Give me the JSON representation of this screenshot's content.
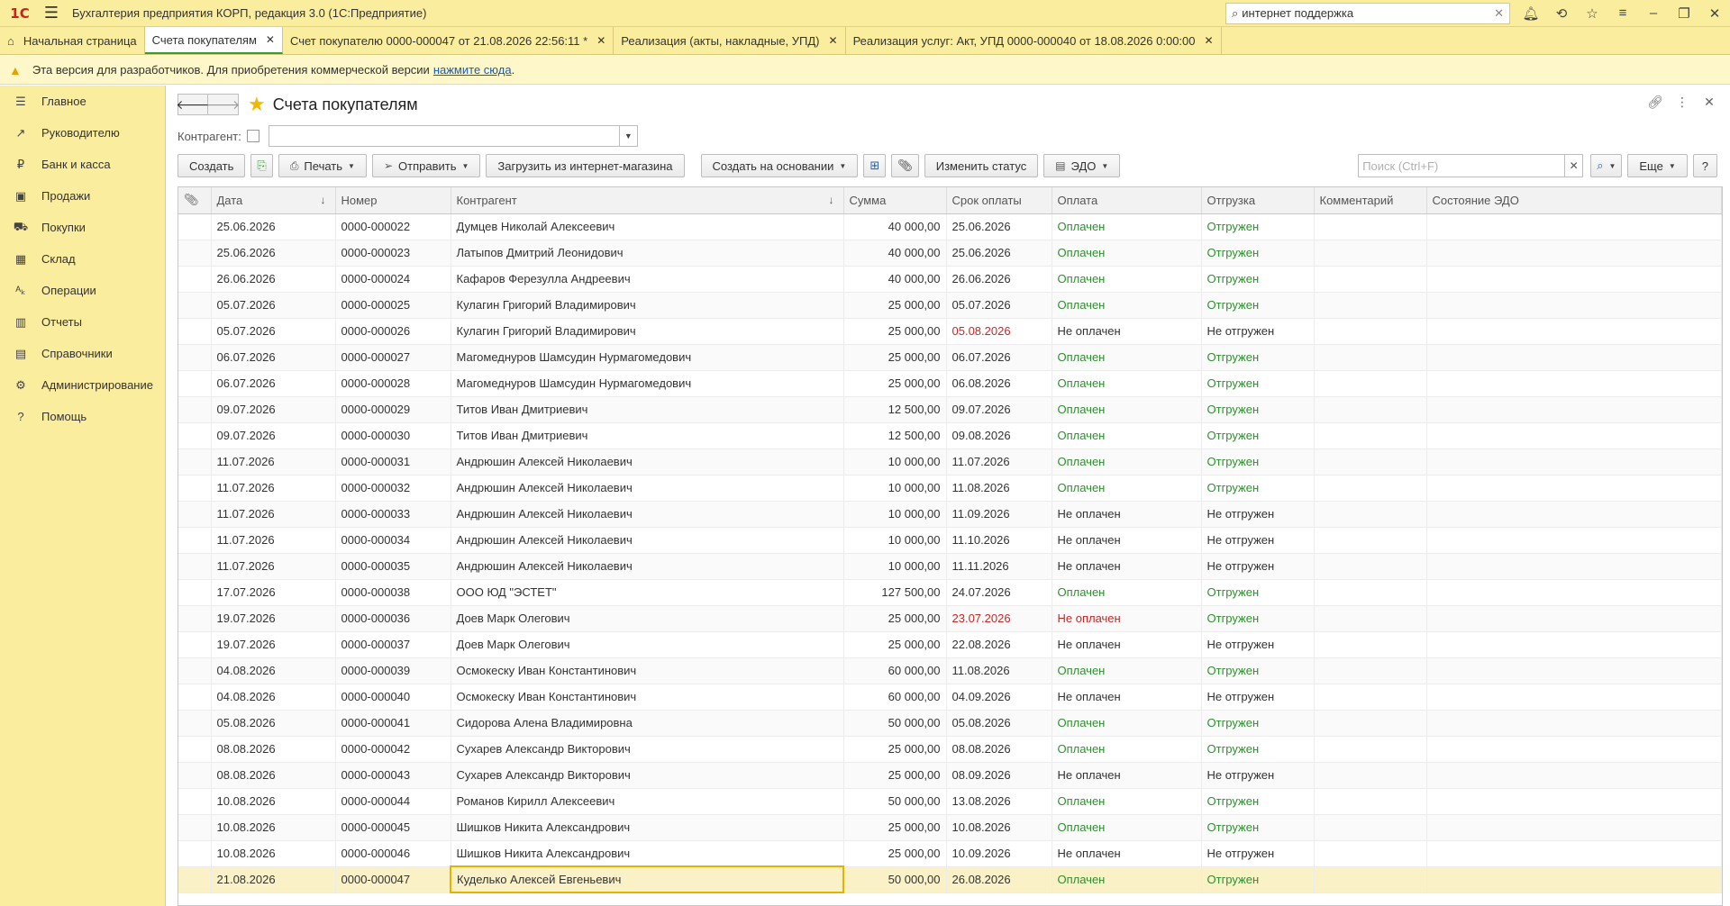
{
  "titlebar": {
    "logo": "1С",
    "app_title": "Бухгалтерия предприятия КОРП, редакция 3.0  (1С:Предприятие)",
    "search_value": "интернет поддержка",
    "icons": [
      "bell-icon",
      "history-icon",
      "star-icon",
      "settings-icon",
      "minimize-icon",
      "restore-icon",
      "close-icon"
    ]
  },
  "tabs": [
    {
      "label": "Начальная страница",
      "closable": false
    },
    {
      "label": "Счета покупателям",
      "closable": true,
      "active": true
    },
    {
      "label": "Счет покупателю 0000-000047 от 21.08.2026 22:56:11 *",
      "closable": true
    },
    {
      "label": "Реализация (акты, накладные, УПД)",
      "closable": true
    },
    {
      "label": "Реализация услуг: Акт, УПД 0000-000040 от 18.08.2026 0:00:00",
      "closable": true
    }
  ],
  "banner": {
    "text": "Эта версия для разработчиков. Для приобретения коммерческой версии",
    "link": "нажмите сюда",
    "suffix": "."
  },
  "sidebar": {
    "items": [
      {
        "label": "Главное",
        "icon": "menu-icon",
        "glyph": "☰"
      },
      {
        "label": "Руководителю",
        "icon": "trend-icon",
        "glyph": "↗"
      },
      {
        "label": "Банк и касса",
        "icon": "ruble-icon",
        "glyph": "₽"
      },
      {
        "label": "Продажи",
        "icon": "bag-icon",
        "glyph": "▣"
      },
      {
        "label": "Покупки",
        "icon": "cart-icon",
        "glyph": "⛟"
      },
      {
        "label": "Склад",
        "icon": "warehouse-icon",
        "glyph": "▦"
      },
      {
        "label": "Операции",
        "icon": "operations-icon",
        "glyph": "ᴬₖ"
      },
      {
        "label": "Отчеты",
        "icon": "reports-icon",
        "glyph": "▥"
      },
      {
        "label": "Справочники",
        "icon": "book-icon",
        "glyph": "▤"
      },
      {
        "label": "Администрирование",
        "icon": "gear-icon",
        "glyph": "⚙"
      },
      {
        "label": "Помощь",
        "icon": "help-icon",
        "glyph": "?"
      }
    ]
  },
  "form": {
    "title": "Счета покупателям",
    "filter_label": "Контрагент:",
    "toolbar": {
      "create": "Создать",
      "print": "Печать",
      "send": "Отправить",
      "load": "Загрузить из интернет-магазина",
      "create_based": "Создать на основании",
      "change_status": "Изменить статус",
      "edo": "ЭДО",
      "search_placeholder": "Поиск (Ctrl+F)",
      "more": "Еще",
      "help": "?"
    },
    "columns": [
      "Дата",
      "Номер",
      "Контрагент",
      "Сумма",
      "Срок оплаты",
      "Оплата",
      "Отгрузка",
      "Комментарий",
      "Состояние ЭДО"
    ]
  },
  "status_colors": {
    "paid": "#2f8f2f",
    "overdue": "#c62828",
    "accent": "#f2b800"
  },
  "rows": [
    {
      "date": "25.06.2026",
      "number": "0000-000022",
      "kontragent": "Думцев Николай Алексеевич",
      "sum": "40 000,00",
      "due": "25.06.2026",
      "payment": "Оплачен",
      "shipment": "Отгружен"
    },
    {
      "date": "25.06.2026",
      "number": "0000-000023",
      "kontragent": "Латыпов Дмитрий Леонидович",
      "sum": "40 000,00",
      "due": "25.06.2026",
      "payment": "Оплачен",
      "shipment": "Отгружен"
    },
    {
      "date": "26.06.2026",
      "number": "0000-000024",
      "kontragent": "Кафаров Ферезулла Андреевич",
      "sum": "40 000,00",
      "due": "26.06.2026",
      "payment": "Оплачен",
      "shipment": "Отгружен"
    },
    {
      "date": "05.07.2026",
      "number": "0000-000025",
      "kontragent": "Кулагин Григорий Владимирович",
      "sum": "25 000,00",
      "due": "05.07.2026",
      "payment": "Оплачен",
      "shipment": "Отгружен"
    },
    {
      "date": "05.07.2026",
      "number": "0000-000026",
      "kontragent": "Кулагин Григорий Владимирович",
      "sum": "25 000,00",
      "due": "05.08.2026",
      "payment": "Не оплачен",
      "shipment": "Не отгружен",
      "due_overdue": true
    },
    {
      "date": "06.07.2026",
      "number": "0000-000027",
      "kontragent": "Магомеднуров Шамсудин Нурмагомедович",
      "sum": "25 000,00",
      "due": "06.07.2026",
      "payment": "Оплачен",
      "shipment": "Отгружен"
    },
    {
      "date": "06.07.2026",
      "number": "0000-000028",
      "kontragent": "Магомеднуров Шамсудин Нурмагомедович",
      "sum": "25 000,00",
      "due": "06.08.2026",
      "payment": "Оплачен",
      "shipment": "Отгружен"
    },
    {
      "date": "09.07.2026",
      "number": "0000-000029",
      "kontragent": "Титов Иван Дмитриевич",
      "sum": "12 500,00",
      "due": "09.07.2026",
      "payment": "Оплачен",
      "shipment": "Отгружен"
    },
    {
      "date": "09.07.2026",
      "number": "0000-000030",
      "kontragent": "Титов Иван Дмитриевич",
      "sum": "12 500,00",
      "due": "09.08.2026",
      "payment": "Оплачен",
      "shipment": "Отгружен"
    },
    {
      "date": "11.07.2026",
      "number": "0000-000031",
      "kontragent": "Андрюшин Алексей Николаевич",
      "sum": "10 000,00",
      "due": "11.07.2026",
      "payment": "Оплачен",
      "shipment": "Отгружен"
    },
    {
      "date": "11.07.2026",
      "number": "0000-000032",
      "kontragent": "Андрюшин Алексей Николаевич",
      "sum": "10 000,00",
      "due": "11.08.2026",
      "payment": "Оплачен",
      "shipment": "Отгружен"
    },
    {
      "date": "11.07.2026",
      "number": "0000-000033",
      "kontragent": "Андрюшин Алексей Николаевич",
      "sum": "10 000,00",
      "due": "11.09.2026",
      "payment": "Не оплачен",
      "shipment": "Не отгружен"
    },
    {
      "date": "11.07.2026",
      "number": "0000-000034",
      "kontragent": "Андрюшин Алексей Николаевич",
      "sum": "10 000,00",
      "due": "11.10.2026",
      "payment": "Не оплачен",
      "shipment": "Не отгружен"
    },
    {
      "date": "11.07.2026",
      "number": "0000-000035",
      "kontragent": "Андрюшин Алексей Николаевич",
      "sum": "10 000,00",
      "due": "11.11.2026",
      "payment": "Не оплачен",
      "shipment": "Не отгружен"
    },
    {
      "date": "17.07.2026",
      "number": "0000-000038",
      "kontragent": "ООО ЮД \"ЭСТЕТ\"",
      "sum": "127 500,00",
      "due": "24.07.2026",
      "payment": "Оплачен",
      "shipment": "Отгружен"
    },
    {
      "date": "19.07.2026",
      "number": "0000-000036",
      "kontragent": "Доев Марк Олегович",
      "sum": "25 000,00",
      "due": "23.07.2026",
      "payment": "Не оплачен",
      "shipment": "Отгружен",
      "due_overdue": true,
      "payment_overdue": true
    },
    {
      "date": "19.07.2026",
      "number": "0000-000037",
      "kontragent": "Доев Марк Олегович",
      "sum": "25 000,00",
      "due": "22.08.2026",
      "payment": "Не оплачен",
      "shipment": "Не отгружен"
    },
    {
      "date": "04.08.2026",
      "number": "0000-000039",
      "kontragent": "Осмокеску Иван Константинович",
      "sum": "60 000,00",
      "due": "11.08.2026",
      "payment": "Оплачен",
      "shipment": "Отгружен"
    },
    {
      "date": "04.08.2026",
      "number": "0000-000040",
      "kontragent": "Осмокеску Иван Константинович",
      "sum": "60 000,00",
      "due": "04.09.2026",
      "payment": "Не оплачен",
      "shipment": "Не отгружен"
    },
    {
      "date": "05.08.2026",
      "number": "0000-000041",
      "kontragent": "Сидорова Алена Владимировна",
      "sum": "50 000,00",
      "due": "05.08.2026",
      "payment": "Оплачен",
      "shipment": "Отгружен"
    },
    {
      "date": "08.08.2026",
      "number": "0000-000042",
      "kontragent": "Сухарев Александр Викторович",
      "sum": "25 000,00",
      "due": "08.08.2026",
      "payment": "Оплачен",
      "shipment": "Отгружен"
    },
    {
      "date": "08.08.2026",
      "number": "0000-000043",
      "kontragent": "Сухарев Александр Викторович",
      "sum": "25 000,00",
      "due": "08.09.2026",
      "payment": "Не оплачен",
      "shipment": "Не отгружен"
    },
    {
      "date": "10.08.2026",
      "number": "0000-000044",
      "kontragent": "Романов Кирилл Алексеевич",
      "sum": "50 000,00",
      "due": "13.08.2026",
      "payment": "Оплачен",
      "shipment": "Отгружен"
    },
    {
      "date": "10.08.2026",
      "number": "0000-000045",
      "kontragent": "Шишков Никита Александрович",
      "sum": "25 000,00",
      "due": "10.08.2026",
      "payment": "Оплачен",
      "shipment": "Отгружен"
    },
    {
      "date": "10.08.2026",
      "number": "0000-000046",
      "kontragent": "Шишков Никита Александрович",
      "sum": "25 000,00",
      "due": "10.09.2026",
      "payment": "Не оплачен",
      "shipment": "Не отгружен"
    },
    {
      "date": "21.08.2026",
      "number": "0000-000047",
      "kontragent": "Куделько Алексей Евгеньевич",
      "sum": "50 000,00",
      "due": "26.08.2026",
      "payment": "Оплачен",
      "shipment": "Отгружен",
      "selected": true
    }
  ]
}
